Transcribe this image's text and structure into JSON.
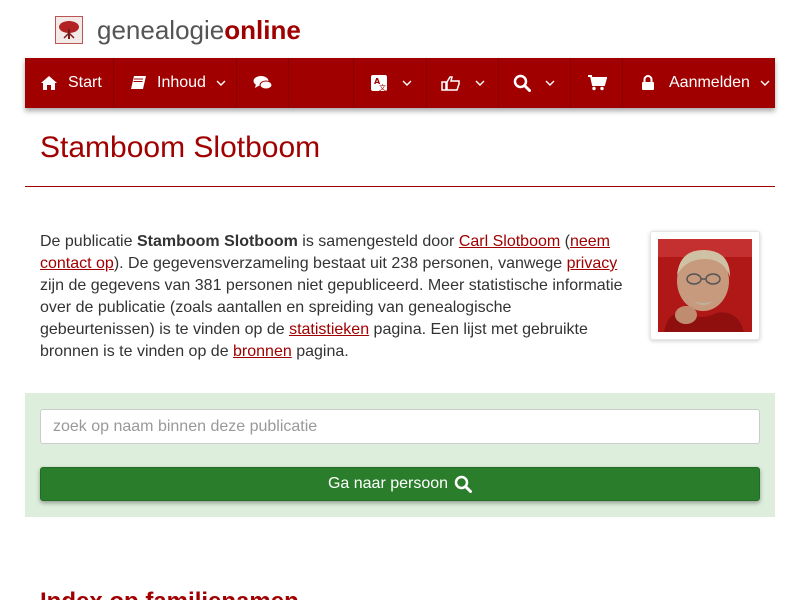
{
  "brand": {
    "name_plain": "genealogie",
    "name_strong": "online"
  },
  "nav": {
    "start_label": "Start",
    "inhoud_label": "Inhoud",
    "login_label": "Aanmelden",
    "icons": [
      "home-icon",
      "book-icon",
      "comments-icon",
      "language-icon",
      "thumbs-up-icon",
      "search-icon",
      "shopping-cart-icon",
      "lock-icon"
    ]
  },
  "page": {
    "title": "Stamboom Slotboom"
  },
  "intro": {
    "t1": "De publicatie ",
    "pub_name": "Stamboom Slotboom",
    "t2": " is samengesteld door ",
    "author_link": "Carl Slotboom",
    "t3": " (",
    "contact_link": "neem contact op",
    "t4": "). De gegevensverzameling bestaat uit 238 personen, vanwege ",
    "privacy_link": "privacy",
    "t5": " zijn de gegevens van 381 personen niet gepubliceerd. Meer statistische informatie over de publicatie (zoals aantallen en spreiding van genealogische gebeurtenissen) is te vinden op de ",
    "stats_link": "statistieken",
    "t6": " pagina. Een lijst met gebruikte bronnen is te vinden op de ",
    "sources_link": "bronnen",
    "t7": " pagina."
  },
  "search": {
    "placeholder": "zoek op naam binnen deze publicatie",
    "value": "",
    "button_label": "Ga naar persoon"
  },
  "section": {
    "title": "Index op familienamen"
  },
  "colors": {
    "brand_red": "#a00000",
    "button_green": "#2a7d2a",
    "panel_green": "#ddeedd"
  }
}
